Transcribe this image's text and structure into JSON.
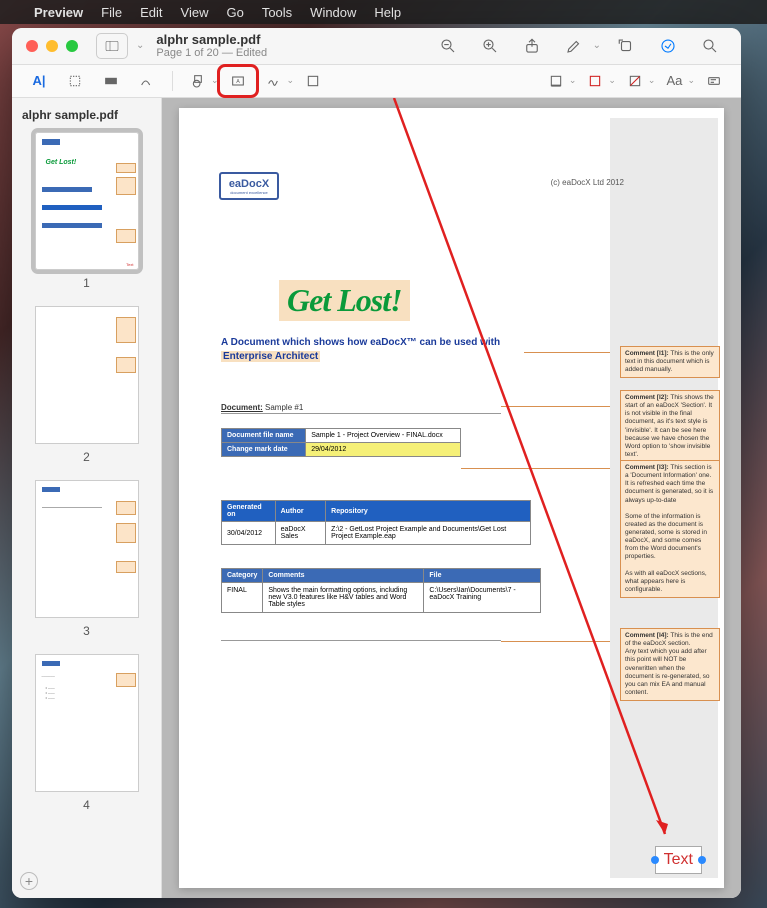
{
  "menubar": {
    "app_name": "Preview",
    "items": [
      "File",
      "Edit",
      "View",
      "Go",
      "Tools",
      "Window",
      "Help"
    ]
  },
  "window": {
    "filename": "alphr sample.pdf",
    "subtitle": "Page 1 of 20 — Edited"
  },
  "sidebar": {
    "title": "alphr sample.pdf",
    "pages": [
      "1",
      "2",
      "3",
      "4"
    ]
  },
  "page": {
    "logo": "eaDocX",
    "logo_sub": "document excellence",
    "copyright": "(c) eaDocX Ltd 2012",
    "getlost": "Get Lost!",
    "title_line1": "A Document which shows how eaDocX™ can be used with",
    "title_line2": "Enterprise Architect",
    "doc_label": "Document:",
    "doc_value": "Sample #1",
    "info_table": {
      "r1c1": "Document file name",
      "r1c2": "Sample 1 - Project Overview - FINAL.docx",
      "r2c1": "Change mark date",
      "r2c2": "29/04/2012"
    },
    "gen_table": {
      "h1": "Generated on",
      "h2": "Author",
      "h3": "Repository",
      "r1c1": "30/04/2012",
      "r1c2": "eaDocX Sales",
      "r1c3": "Z:\\2 - GetLost Project Example and Documents\\Get Lost Project Example.eap"
    },
    "cat_table": {
      "h1": "Category",
      "h2": "Comments",
      "h3": "File",
      "r1c1": "FINAL",
      "r1c2": "Shows the main formatting options, including new V3.0 features like H&V tables and Word Table styles",
      "r1c3": "C:\\Users\\Ian\\Documents\\7 - eaDocX Training"
    },
    "comments": {
      "c1_label": "Comment [I1]:",
      "c1_text": "This is the only text in this document which is added manually.",
      "c2_label": "Comment [I2]:",
      "c2_text": "This shows the start of an eaDocX 'Section'. It is not visible in the final document, as it's text style is 'invisible'. It can be see here because we have chosen the Word option to 'show invisible text'.",
      "c3_label": "Comment [I3]:",
      "c3_text": "This section is a 'Document Information' one. It is refreshed each time the document is generated, so it is always up-to-date",
      "c3_text2": "Some of the information is created as the document is generated, some is stored in eaDocX, and some comes from the Word document's properties.",
      "c3_text3": "As with all eaDocX sections, what appears here is configurable.",
      "c4_label": "Comment [I4]:",
      "c4_text": "This is the end of the eaDocX section.",
      "c4_text2": "Any text which you add after this point will NOT be overwritten when the document is re-generated, so you can mix EA and manual content."
    }
  },
  "textbox": {
    "label": "Text"
  }
}
